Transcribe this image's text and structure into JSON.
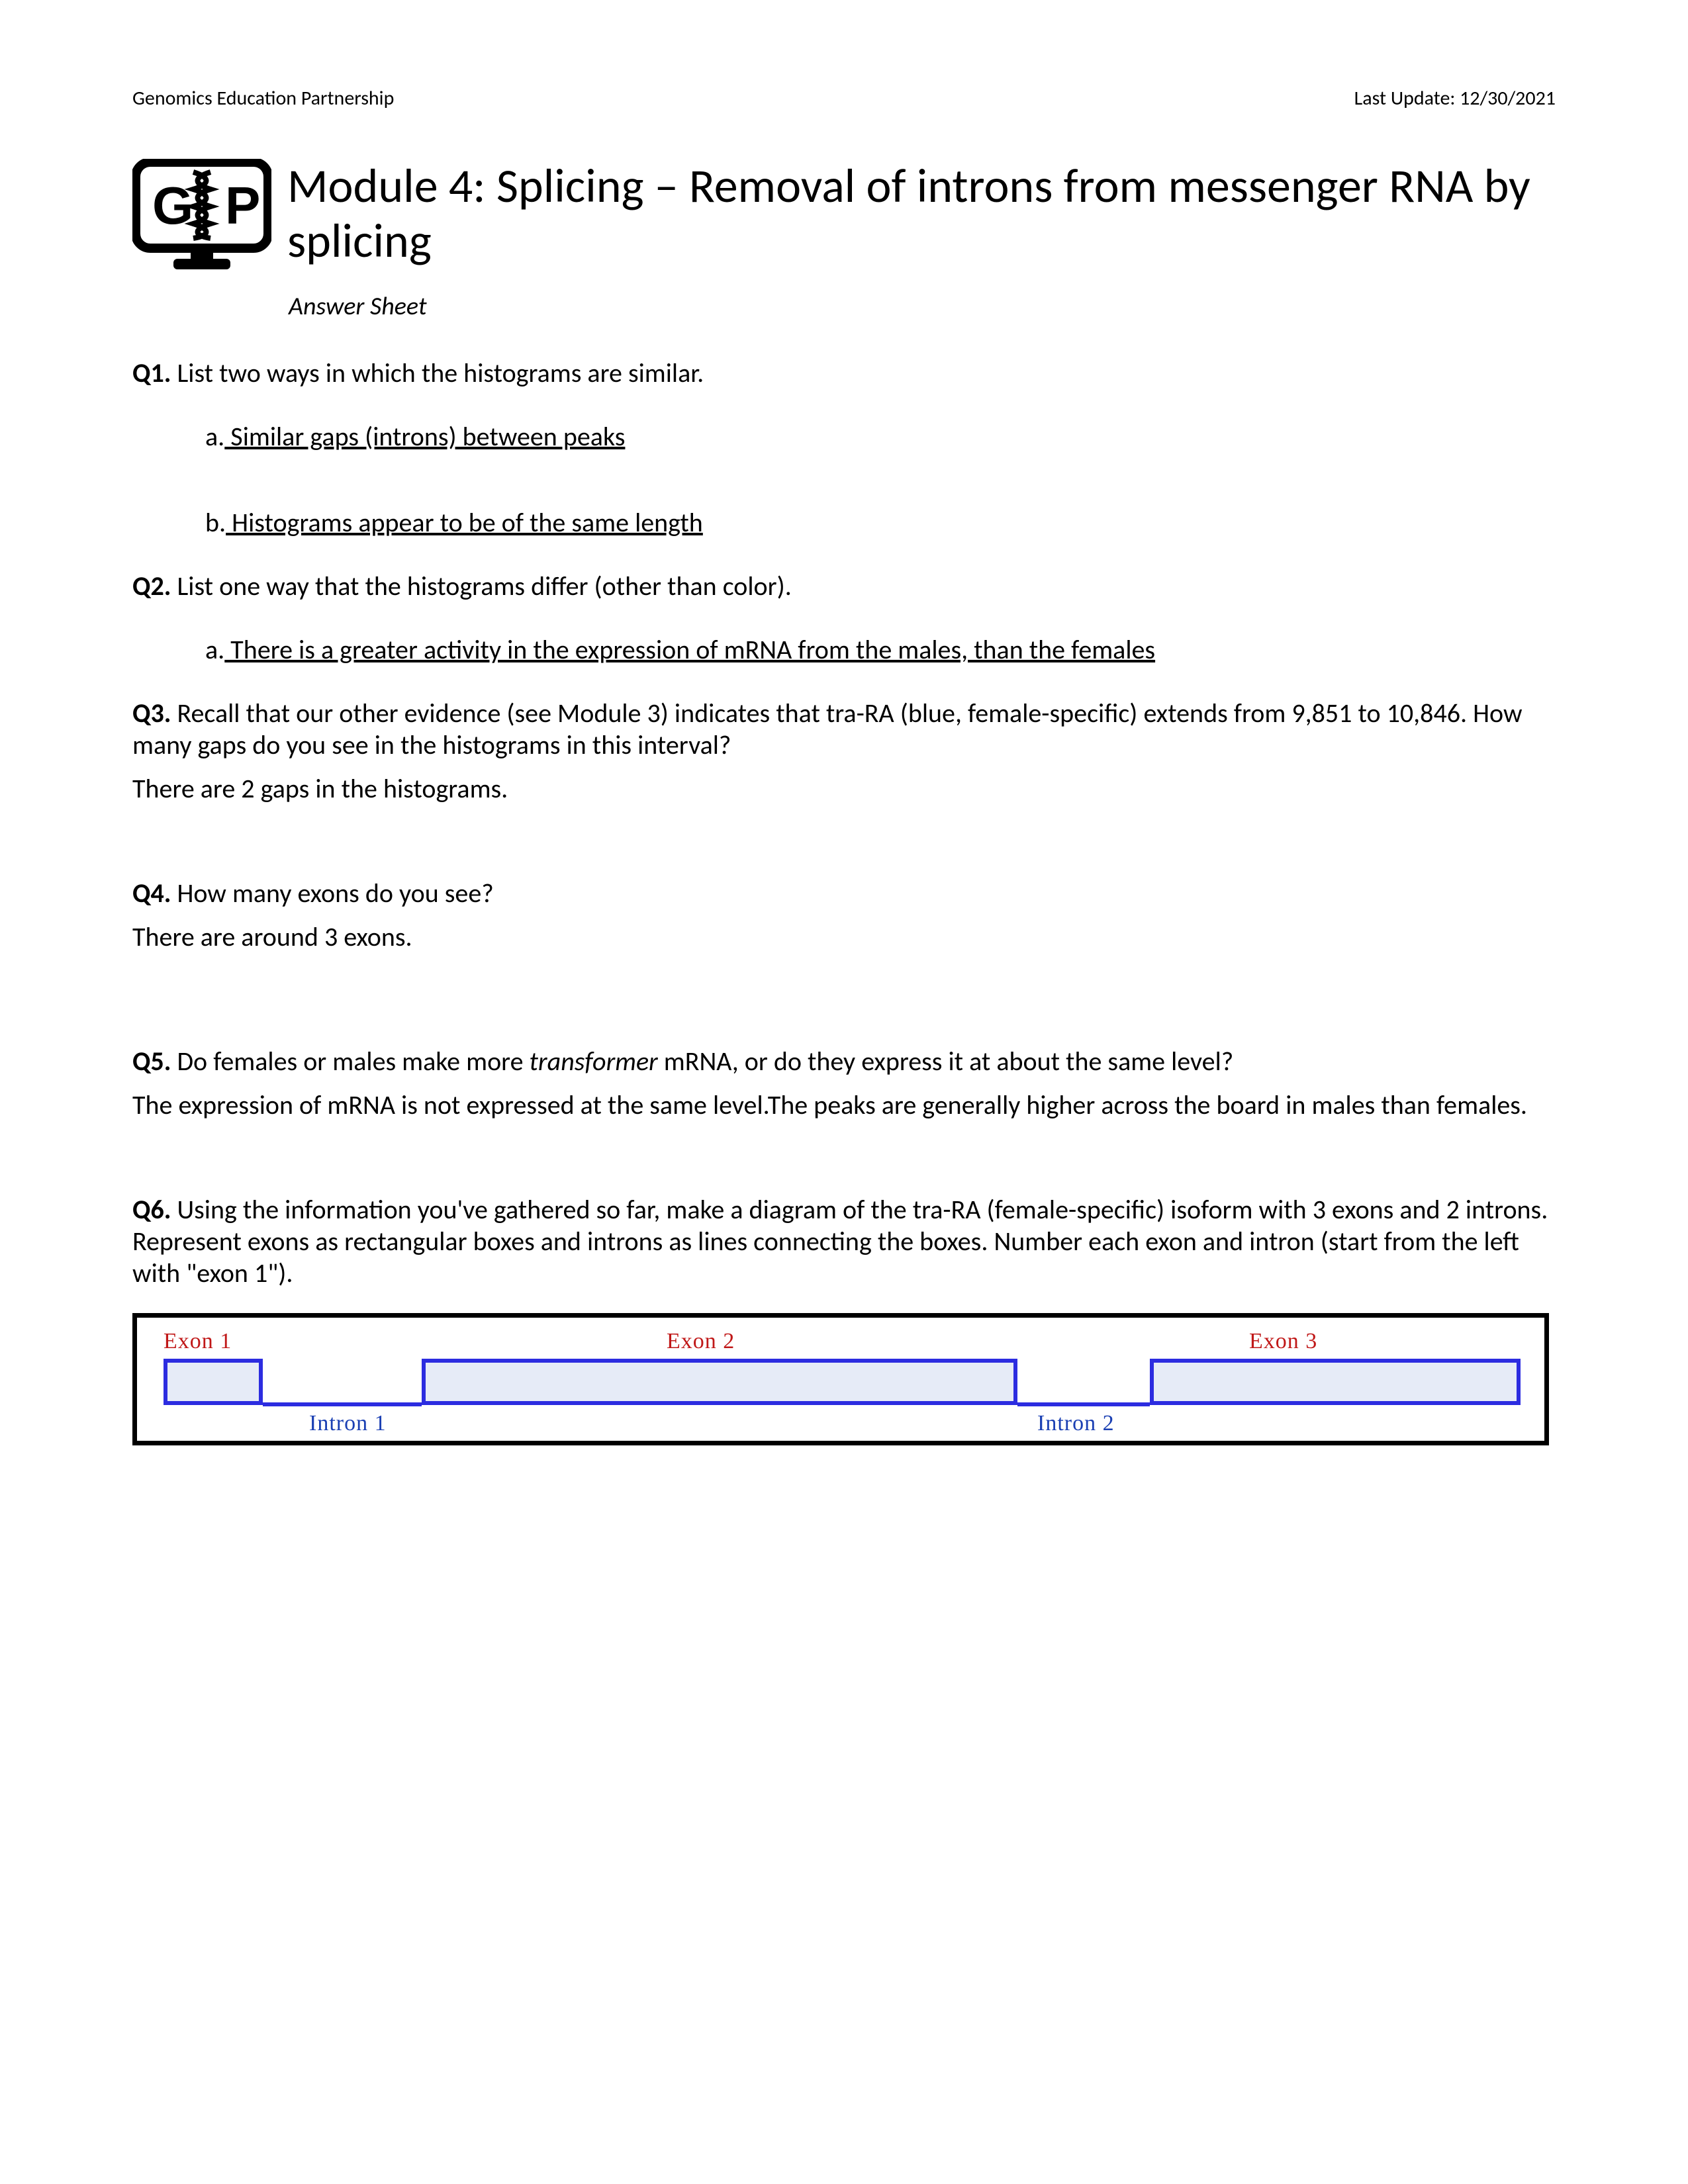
{
  "header": {
    "org": "Genomics Education Partnership",
    "update": "Last Update: 12/30/2021"
  },
  "logo": {
    "text_g": "G",
    "text_p": "P"
  },
  "title": "Module 4: Splicing – Removal of introns from messenger RNA by splicing",
  "subtitle": "Answer Sheet",
  "q1": {
    "label": "Q1.",
    "prompt": " List two ways in which the histograms are similar.",
    "a_label": "a.",
    "a_text": " Similar gaps (introns) between peaks",
    "b_label": "b.",
    "b_text": " Histograms appear to be of the same length"
  },
  "q2": {
    "label": "Q2.",
    "prompt": " List one way that the histograms differ (other than color).",
    "a_label": "a.",
    "a_text": " There is a greater activity in the expression of mRNA from the males, than the females"
  },
  "q3": {
    "label": "Q3.",
    "prompt": " Recall that our other evidence (see Module 3) indicates that tra-RA (blue, female-specific) extends from 9,851 to 10,846. How many gaps do you see in the histograms in this interval?",
    "answer": "There are 2 gaps in the histograms."
  },
  "q4": {
    "label": "Q4.",
    "prompt": " How many exons do you see?",
    "answer": "There are around 3 exons."
  },
  "q5": {
    "label": "Q5.",
    "prompt_pre": " Do females or males make more ",
    "prompt_ital": "transformer",
    "prompt_post": " mRNA, or do they express it at about the same level?",
    "answer": "The expression of mRNA is not expressed at the same level.The peaks are generally higher across the board in males than females."
  },
  "q6": {
    "label": "Q6.",
    "prompt": " Using the information you've gathered so far, make a diagram of the tra-RA (female-specific) isoform with 3 exons and 2 introns. Represent exons as rectangular boxes and introns as lines connecting the boxes. Number each exon and intron (start from the left with \"exon 1\")."
  },
  "diagram": {
    "exon1": "Exon 1",
    "exon2": "Exon 2",
    "exon3": "Exon 3",
    "intron1": "Intron 1",
    "intron2": "Intron 2"
  }
}
